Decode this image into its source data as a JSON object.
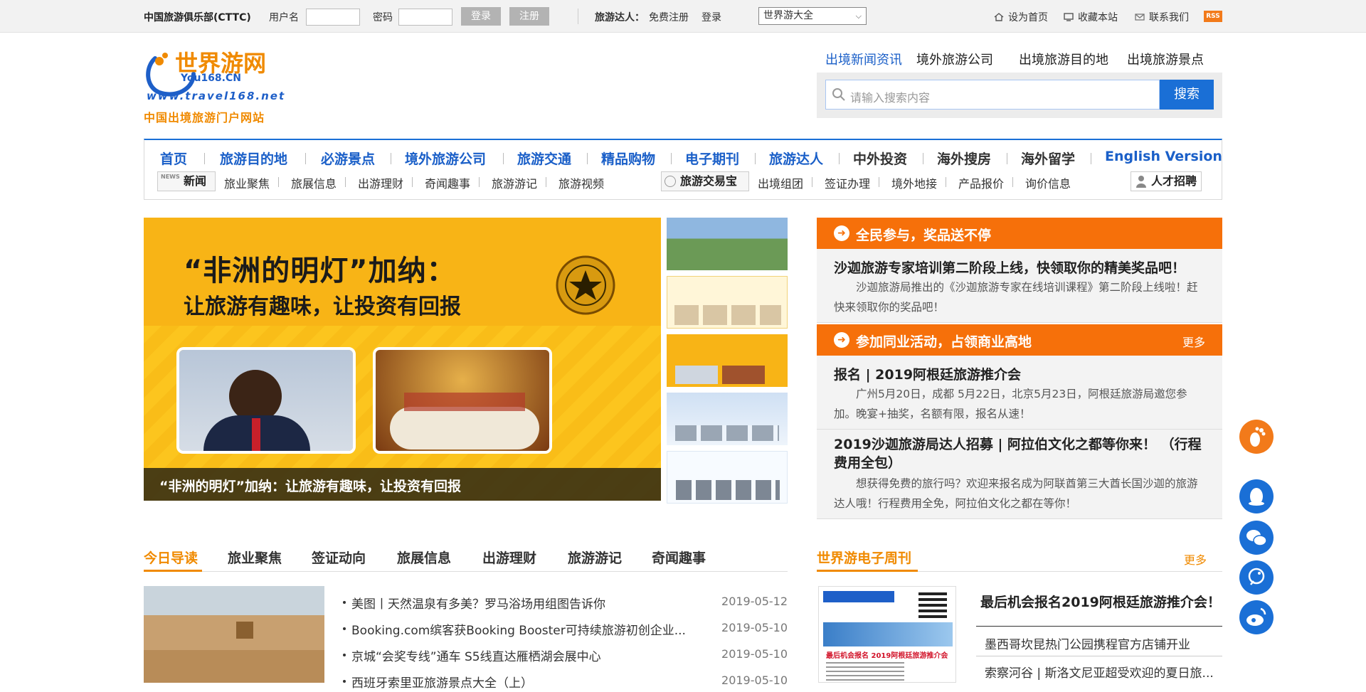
{
  "topbar": {
    "club": "中国旅游俱乐部(CTTC)",
    "username_label": "用户名",
    "password_label": "密码",
    "login_btn": "登录",
    "register_btn": "注册",
    "talent_label": "旅游达人：",
    "free_register": "免费注册",
    "login_link": "登录",
    "select_value": "世界游大全",
    "set_home": "设为首页",
    "bookmark": "收藏本站",
    "contact": "联系我们",
    "rss": "RSS"
  },
  "logo": {
    "brand": "世界游网",
    "sub": "You168.CN",
    "url": "www.travel168.net",
    "tagline": "中国出境旅游门户网站"
  },
  "search": {
    "tabs": [
      "出境新闻资讯",
      "境外旅游公司",
      "出境旅游目的地",
      "出境旅游景点"
    ],
    "placeholder": "请输入搜索内容",
    "button": "搜索"
  },
  "nav": {
    "main": [
      "首页",
      "旅游目的地",
      "必游景点",
      "境外旅游公司",
      "旅游交通",
      "精品购物",
      "电子期刊",
      "旅游达人",
      "中外投资",
      "海外搜房",
      "海外留学",
      "English Version"
    ],
    "news_badge": "新闻",
    "news_items": [
      "旅业聚焦",
      "旅展信息",
      "出游理财",
      "奇闻趣事",
      "旅游游记",
      "旅游视频"
    ],
    "trade_badge": "旅游交易宝",
    "trade_items": [
      "出境组团",
      "签证办理",
      "境外地接",
      "产品报价",
      "询价信息"
    ],
    "jobs": "人才招聘"
  },
  "banner": {
    "headline": "“非洲的明灯”加纳：",
    "subline": "让旅游有趣味，让投资有回报",
    "caption": "“非洲的明灯”加纳：让旅游有趣味，让投资有回报"
  },
  "promo": {
    "head1": "全民参与，奖品送不停",
    "item1_title": "沙迦旅游专家培训第二阶段上线，快领取你的精美奖品吧！",
    "item1_desc": "沙迦旅游局推出的《沙迦旅游专家在线培训课程》第二阶段上线啦！赶快来领取你的奖品吧！",
    "head2": "参加同业活动，占领商业高地",
    "more": "更多",
    "item2_title": "报名 | 2019阿根廷旅游推介会",
    "item2_desc": "广州5月20日，成都 5月22日，北京5月23日，阿根廷旅游局邀您参加。晚宴+抽奖，名额有限，报名从速！",
    "item3_title": "2019沙迦旅游局达人招募 | 阿拉伯文化之都等你来！ （行程费用全包）",
    "item3_desc": "想获得免费的旅行吗？欢迎来报名成为阿联酋第三大酋长国沙迦的旅游达人哦！行程费用全免，阿拉伯文化之都在等你！"
  },
  "today": {
    "tabs": [
      "今日导读",
      "旅业聚焦",
      "签证动向",
      "旅展信息",
      "出游理财",
      "旅游游记",
      "奇闻趣事"
    ],
    "items": [
      {
        "title": "美图丨天然温泉有多美？罗马浴场用组图告诉你",
        "date": "2019-05-12"
      },
      {
        "title": "Booking.com缤客获Booking Booster可持续旅游初创企业...",
        "date": "2019-05-10"
      },
      {
        "title": "京城“会奖专线”通车 S5线直达雁栖湖会展中心",
        "date": "2019-05-10"
      },
      {
        "title": "西班牙索里亚旅游景点大全（上）",
        "date": "2019-05-10"
      }
    ]
  },
  "weekly": {
    "title": "世界游电子周刊",
    "more": "更多",
    "feature": "最后机会报名2019阿根廷旅游推介会！",
    "items": [
      "墨西哥坎昆热门公园携程官方店铺开业",
      "索察河谷 | 斯洛文尼亚超受欢迎的夏日旅..."
    ],
    "cover_text": "最后机会报名 2019阿根廷旅游推介会"
  },
  "colors": {
    "accent_blue": "#1a6fd6",
    "accent_orange": "#f6700a",
    "brand_orange": "#f08a00"
  }
}
